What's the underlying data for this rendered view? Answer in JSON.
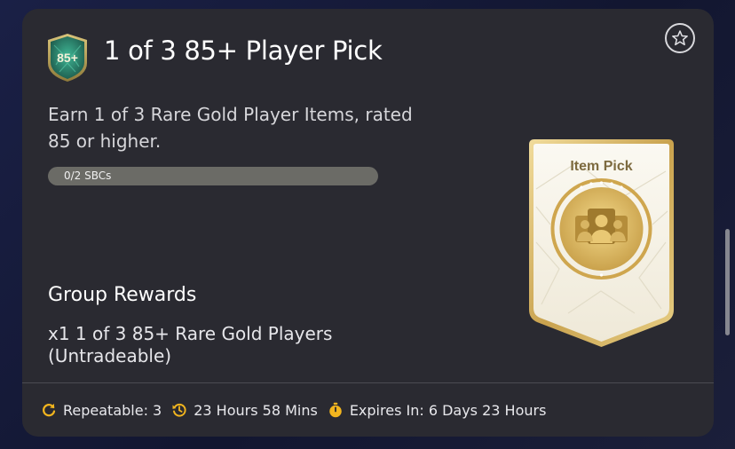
{
  "card": {
    "badge_text": "85+",
    "title": "1 of 3 85+ Player Pick",
    "description": "Earn 1 of 3 Rare Gold Player Items, rated 85 or higher.",
    "progress": {
      "label": "0/2 SBCs",
      "completed": 0,
      "total": 2
    },
    "rewards": {
      "heading": "Group Rewards",
      "text": "x1 1 of 3 85+ Rare Gold Players (Untradeable)"
    },
    "item_card": {
      "label": "Item Pick"
    },
    "footer": {
      "repeatable": "Repeatable: 3",
      "time_left": "23 Hours 58 Mins",
      "expires": "Expires In: 6 Days 23 Hours"
    }
  },
  "colors": {
    "accent_gold": "#f2b51e",
    "card_bg": "#2a2a31",
    "progress_track": "#6b6b66",
    "item_card_gold": "#d7b867"
  },
  "icons": [
    "85-plus-badge-icon",
    "star-icon",
    "repeat-icon",
    "history-clock-icon",
    "stopwatch-icon",
    "players-silhouette-icon"
  ]
}
